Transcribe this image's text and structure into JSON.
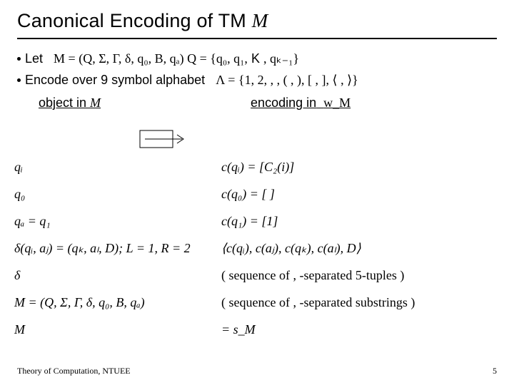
{
  "title_prefix": "Canonical Encoding of TM ",
  "title_M": "M",
  "bullet1_text": "Let",
  "bullet1_math": "M = (Q, Σ, Γ, δ, q₀, B, qₐ)   Q = {q₀, q₁,",
  "bullet1_K": "K",
  "bullet1_math_tail": ", qₖ₋₁}",
  "bullet2_text": "Encode over 9 symbol alphabet",
  "bullet2_math": "Λ = {1, 2, , , ( , ), [ , ], ⟨ , ⟩}",
  "col1_header": "object in ",
  "col1_header_M": "M",
  "col2_header": "encoding in",
  "col2_header_tail": "w_M",
  "rows": {
    "r0": {
      "left": "qᵢ",
      "right": "c(qᵢ) = [C₂(i)]"
    },
    "r1": {
      "left": "q₀",
      "right": "c(q₀) = [ ]"
    },
    "r2": {
      "left": "qₐ = q₁",
      "right": "c(q₁) = [1]"
    },
    "r3": {
      "left": "δ(qᵢ, aⱼ) = (qₖ, aₗ, D); L = 1, R = 2",
      "right": "⟨c(qᵢ), c(aⱼ), c(qₖ), c(aₗ), D⟩"
    },
    "r4": {
      "left": "δ",
      "right": "( sequence of , -separated  5-tuples )"
    },
    "r5": {
      "left": "M = (Q, Σ, Γ, δ, q₀, B, qₐ)",
      "right": "( sequence of , -separated substrings )"
    },
    "r6": {
      "left": "M",
      "right": "= s_M"
    }
  },
  "footer_left": "Theory of Computation, NTUEE",
  "footer_right": "5"
}
